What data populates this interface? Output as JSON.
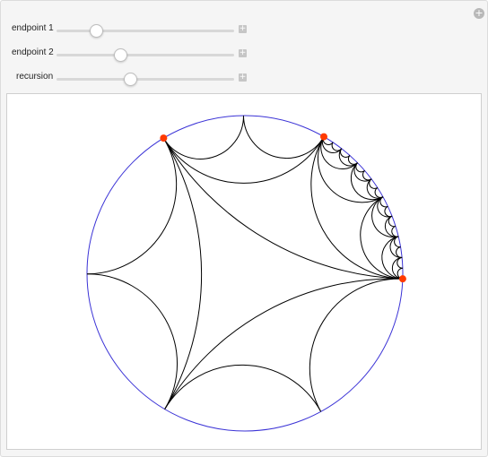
{
  "controls": {
    "endpoint1": {
      "label": "endpoint 1",
      "value_fraction": 0.2
    },
    "endpoint2": {
      "label": "endpoint 2",
      "value_fraction": 0.35
    },
    "recursion": {
      "label": "recursion",
      "value_fraction": 0.41
    }
  },
  "icons": {
    "panel_toggle": "plus-circle-icon",
    "slider_expand": "plus-square-icon"
  },
  "colors": {
    "circle": "#3b33d6",
    "arcs": "#000000",
    "endpoints": "#ff3a00"
  },
  "plot": {
    "endpoint_angles_deg": [
      121,
      60,
      -2
    ],
    "recursion_depth": 4
  }
}
